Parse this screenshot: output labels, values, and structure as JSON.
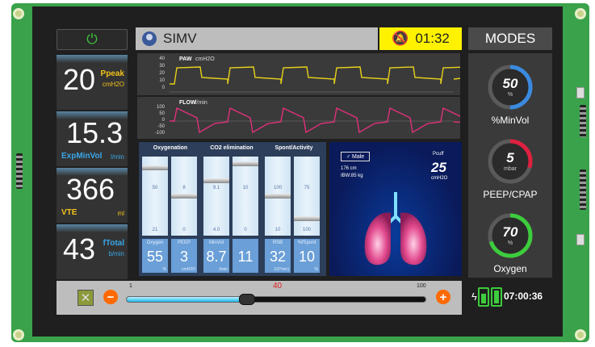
{
  "header": {
    "mode_name": "SIMV",
    "alarm_timer": "01:32",
    "modes_label": "MODES"
  },
  "left_params": [
    {
      "value": "20",
      "label": "Ppeak",
      "unit": "cmH2O",
      "color": "#f2c21b"
    },
    {
      "value": "15.3",
      "label": "ExpMinVol",
      "unit": "l/min",
      "color": "#3aa6e8"
    },
    {
      "value": "366",
      "label": "VTE",
      "unit": "ml",
      "color": "#f2c21b"
    },
    {
      "value": "43",
      "label": "fTotal",
      "unit": "b/min",
      "color": "#3aa6e8"
    }
  ],
  "waveforms": {
    "paw": {
      "name": "PAW",
      "unit": "cmH2O",
      "ticks": [
        "40",
        "30",
        "20",
        "10",
        "0"
      ],
      "color": "#e8d21a"
    },
    "flow": {
      "name": "FLOW",
      "unit": "l/min",
      "ticks": [
        "100",
        "50",
        "0",
        "-50",
        "-100"
      ],
      "color": "#e0307a"
    }
  },
  "measurements": {
    "groups": [
      "Oxygenation",
      "CO2 elimination",
      "Spont/Activity"
    ],
    "columns": [
      {
        "label": "Oxygen",
        "value": "55",
        "unit": "%",
        "top": "",
        "mid": "50",
        "bottom": "21",
        "level": 0.9
      },
      {
        "label": "PEEP",
        "value": "3",
        "unit": "cmH2O",
        "top": "",
        "mid": "8",
        "bottom": "0",
        "level": 0.5
      },
      {
        "label": "MinVol",
        "value": "8.7",
        "unit": "l/min",
        "top": "",
        "mid": "9.1",
        "bottom": "4.0",
        "level": 0.72
      },
      {
        "label": "",
        "value": "11",
        "unit": "",
        "top": "",
        "mid": "10",
        "bottom": "0",
        "level": 0.95
      },
      {
        "label": "RSB",
        "value": "32",
        "unit": "1/(l*min)",
        "top": "",
        "mid": "100",
        "bottom": "10",
        "level": 0.5
      },
      {
        "label": "%fSpont",
        "value": "10",
        "unit": "%",
        "top": "",
        "mid": "75",
        "bottom": "100",
        "level": 0.18
      }
    ]
  },
  "patient": {
    "sex": "Male",
    "height": "176 cm",
    "ibw": "IBW:85 kg",
    "pcuff_label": "Pcuff",
    "pcuff_value": "25",
    "pcuff_unit": "cmH2O"
  },
  "modes": [
    {
      "value": "50",
      "unit": "%",
      "label": "%MinVol",
      "fraction": 0.5,
      "color": "#3a8ae0"
    },
    {
      "value": "5",
      "unit": "mbar",
      "label": "PEEP/CPAP",
      "fraction": 0.3,
      "color": "#e02040"
    },
    {
      "value": "70",
      "unit": "%",
      "label": "Oxygen",
      "fraction": 0.7,
      "color": "#3ccc3c"
    }
  ],
  "slider": {
    "min": "1",
    "max": "100",
    "value": "40",
    "fraction": 0.4
  },
  "status": {
    "clock": "07:00:36"
  }
}
